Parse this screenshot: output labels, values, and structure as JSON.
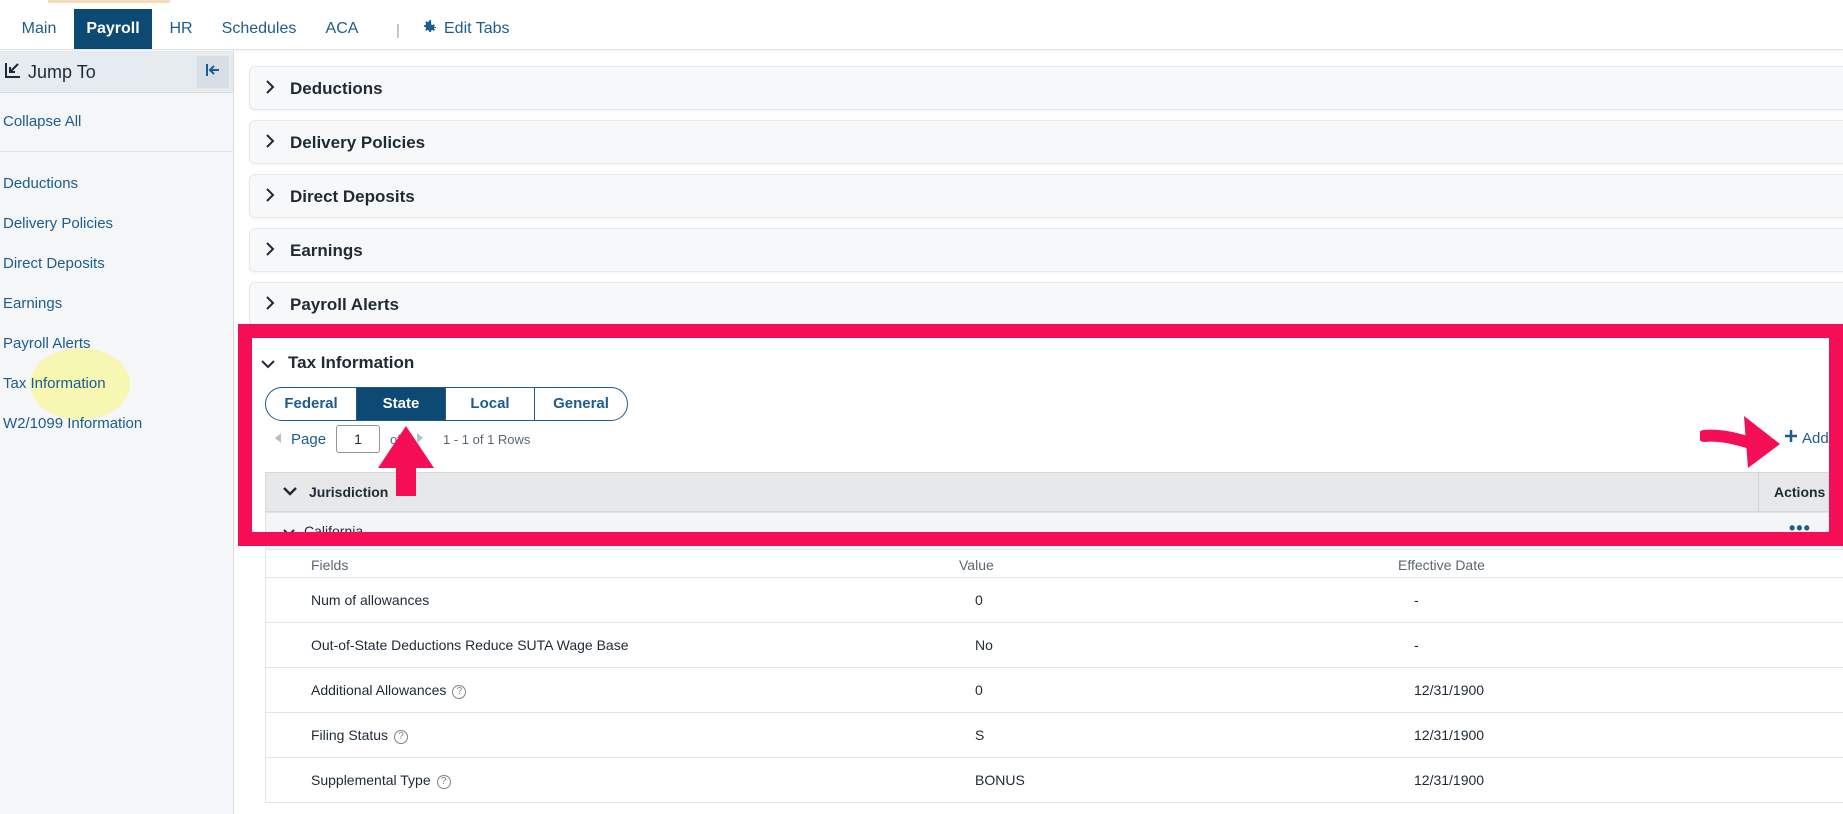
{
  "topnav": {
    "tabs": [
      "Main",
      "Payroll",
      "HR",
      "Schedules",
      "ACA"
    ],
    "active_tab": "Payroll",
    "separator": "|",
    "edit_tabs_label": "Edit Tabs",
    "edit_icon": "gear-icon"
  },
  "sidebar": {
    "header_label": "Jump To",
    "header_icon": "jump-to-icon",
    "collapse_icon": "collapse-left-icon",
    "collapse_all_label": "Collapse All",
    "items": [
      {
        "label": "Deductions"
      },
      {
        "label": "Delivery Policies"
      },
      {
        "label": "Direct Deposits"
      },
      {
        "label": "Earnings"
      },
      {
        "label": "Payroll Alerts"
      },
      {
        "label": "Tax Information"
      },
      {
        "label": "W2/1099 Information"
      }
    ],
    "highlighted_item": "Tax Information"
  },
  "sections": [
    {
      "title": "Deductions",
      "expanded": false
    },
    {
      "title": "Delivery Policies",
      "expanded": false
    },
    {
      "title": "Direct Deposits",
      "expanded": false
    },
    {
      "title": "Earnings",
      "expanded": false
    },
    {
      "title": "Payroll Alerts",
      "expanded": false
    },
    {
      "title": "Tax Information",
      "expanded": true
    }
  ],
  "tax_info": {
    "tabs": [
      "Federal",
      "State",
      "Local",
      "General"
    ],
    "active_tab": "State",
    "pager": {
      "page_label": "Page",
      "page_value": "1",
      "of_label": "of",
      "rows_info": "1 - 1 of 1 Rows"
    },
    "add_label": "Add",
    "grid": {
      "columns": [
        "Jurisdiction",
        "Actions"
      ],
      "group_row": "California",
      "actions_icon": "more-options-icon",
      "field_headers": [
        "Fields",
        "Value",
        "Effective Date"
      ],
      "rows": [
        {
          "field": "Num of allowances",
          "value": "0",
          "effective_date": "-",
          "help": false
        },
        {
          "field": "Out-of-State Deductions Reduce SUTA Wage Base",
          "value": "No",
          "effective_date": "-",
          "help": false
        },
        {
          "field": "Additional Allowances",
          "value": "0",
          "effective_date": "12/31/1900",
          "help": true
        },
        {
          "field": "Filing Status",
          "value": "S",
          "effective_date": "12/31/1900",
          "help": true
        },
        {
          "field": "Supplemental Type",
          "value": "BONUS",
          "effective_date": "12/31/1900",
          "help": true
        }
      ]
    }
  },
  "colors": {
    "brand_dark": "#0d4a73",
    "link": "#1d5c8f",
    "annotation_red": "#f50d55",
    "highlight_yellow": "#f6f778"
  }
}
